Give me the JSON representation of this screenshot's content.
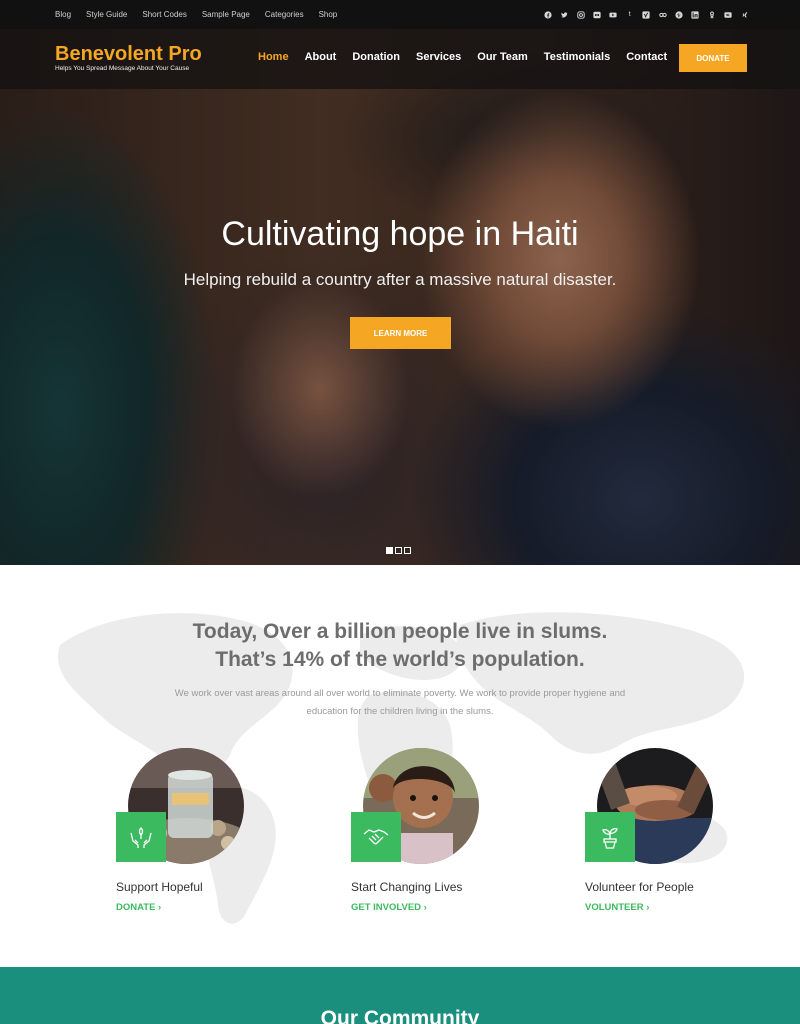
{
  "topbar": {
    "links": [
      "Blog",
      "Style Guide",
      "Short Codes",
      "Sample Page",
      "Categories",
      "Shop"
    ],
    "social_icons": [
      "facebook-icon",
      "twitter-icon",
      "instagram-icon",
      "flickr-icon",
      "youtube-icon",
      "tumblr-icon",
      "vimeo-icon",
      "stumbleupon-icon",
      "pinterest-icon",
      "linkedin-icon",
      "odnoklassniki-icon",
      "vk-icon",
      "xing-icon"
    ]
  },
  "header": {
    "site_title": "Benevolent Pro",
    "tagline": "Helps You Spread Message About Your Cause",
    "menu": [
      {
        "label": "Home",
        "active": true
      },
      {
        "label": "About",
        "active": false
      },
      {
        "label": "Donation",
        "active": false
      },
      {
        "label": "Services",
        "active": false
      },
      {
        "label": "Our Team",
        "active": false
      },
      {
        "label": "Testimonials",
        "active": false
      },
      {
        "label": "Contact",
        "active": false
      }
    ],
    "donate_label": "DONATE"
  },
  "hero": {
    "title": "Cultivating hope in Haiti",
    "subtitle": "Helping rebuild a country after a massive natural disaster.",
    "button_label": "LEARN MORE",
    "slides": 3,
    "active_slide": 1
  },
  "mission": {
    "heading_line1": "Today, Over a billion people live in slums.",
    "heading_line2": "That’s 14% of the world’s population.",
    "description": "We work over vast areas around all over world to eliminate poverty. We work to provide proper hygiene and education for the children living in the slums.",
    "cards": [
      {
        "title": "Support Hopeful",
        "link": "DONATE",
        "icon": "hands-icon"
      },
      {
        "title": "Start Changing Lives",
        "link": "GET INVOLVED",
        "icon": "handshake-icon"
      },
      {
        "title": "Volunteer for People",
        "link": "VOLUNTEER",
        "icon": "plant-icon"
      }
    ]
  },
  "community": {
    "title": "Our Community"
  },
  "colors": {
    "accent": "#f5a623",
    "green": "#3cba5f",
    "teal": "#1a8f7e",
    "topbar": "#111111"
  }
}
